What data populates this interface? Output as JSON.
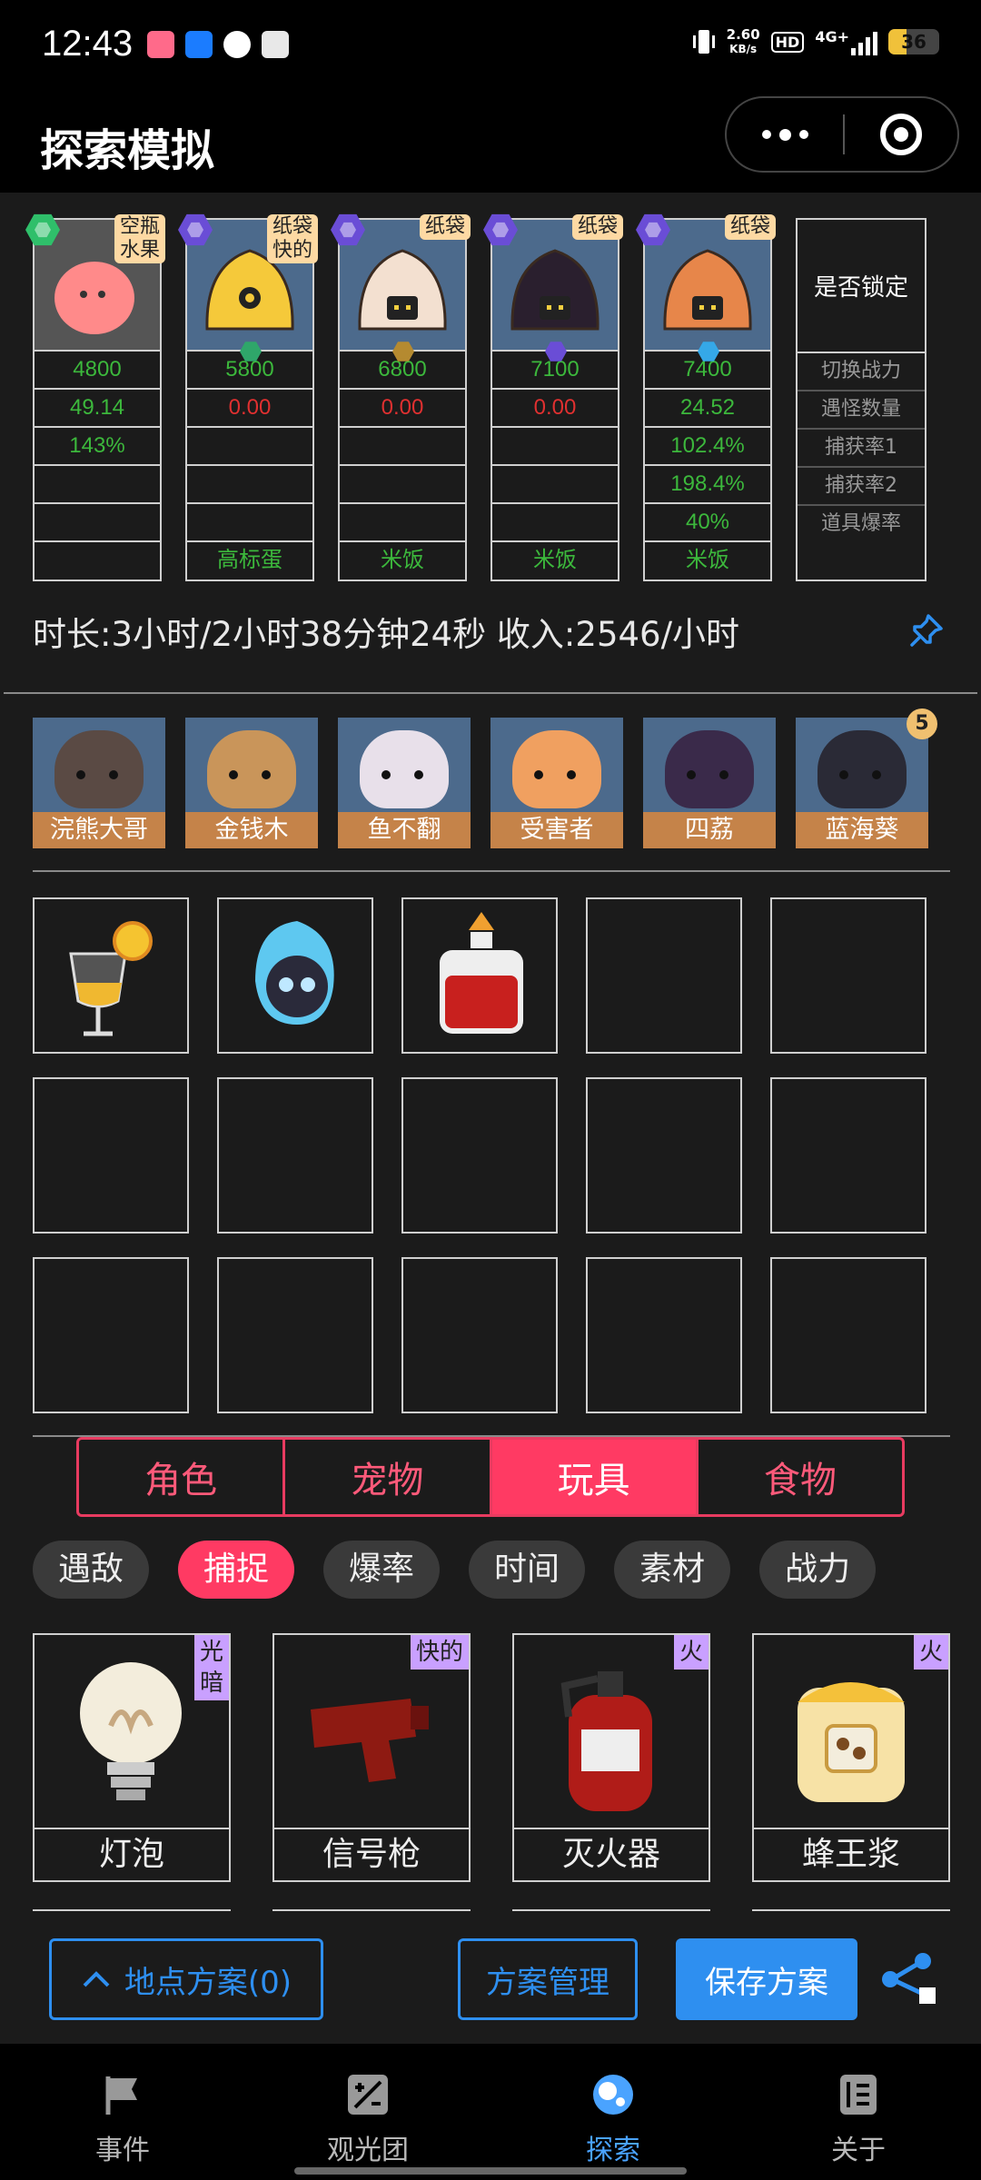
{
  "status": {
    "time": "12:43",
    "speed_top": "2.60",
    "speed_bottom": "KB/s",
    "hd": "HD",
    "network": "4G+",
    "battery": "36",
    "battery_level": 0.36
  },
  "title": "探索模拟",
  "team": [
    {
      "tag": "空瓶\n水果",
      "power": "4800",
      "escape": "49.14",
      "rate1": "143%",
      "rate2": "",
      "drop": "",
      "egg": "",
      "escape_color": "green"
    },
    {
      "tag": "纸袋\n快的",
      "power": "5800",
      "escape": "0.00",
      "rate1": "",
      "rate2": "",
      "drop": "",
      "egg": "高标蛋",
      "escape_color": "red"
    },
    {
      "tag": "纸袋",
      "power": "6800",
      "escape": "0.00",
      "rate1": "",
      "rate2": "",
      "drop": "",
      "egg": "米饭",
      "escape_color": "red"
    },
    {
      "tag": "纸袋",
      "power": "7100",
      "escape": "0.00",
      "rate1": "",
      "rate2": "",
      "drop": "",
      "egg": "米饭",
      "escape_color": "red"
    },
    {
      "tag": "纸袋",
      "power": "7400",
      "escape": "24.52",
      "rate1": "102.4%",
      "rate2": "198.4%",
      "drop": "40%",
      "egg": "米饭",
      "escape_color": "green"
    }
  ],
  "labels": {
    "lock": "是否锁定",
    "power": "切换战力",
    "escape": "遇怪数量",
    "rate1": "捕获率1",
    "rate2": "捕获率2",
    "drop": "道具爆率"
  },
  "summary": "时长:3小时/2小时38分钟24秒 收入:2546/小时",
  "pets": [
    {
      "name": "浣熊大哥"
    },
    {
      "name": "金钱木"
    },
    {
      "name": "鱼不翻"
    },
    {
      "name": "受害者"
    },
    {
      "name": "四荔"
    },
    {
      "name": "蓝海葵",
      "badge": "5"
    }
  ],
  "category_tabs": [
    "角色",
    "宠物",
    "玩具",
    "食物"
  ],
  "active_tab": "玩具",
  "filter_chips": [
    "遇敌",
    "捕捉",
    "爆率",
    "时间",
    "素材",
    "战力"
  ],
  "active_chip": "捕捉",
  "toys": [
    {
      "name": "灯泡",
      "tag": "光\n暗"
    },
    {
      "name": "信号枪",
      "tag": "快的"
    },
    {
      "name": "灭火器",
      "tag": "火"
    },
    {
      "name": "蜂王浆",
      "tag": "火"
    }
  ],
  "actions": {
    "location_plan": "地点方案(0)",
    "plan_manage": "方案管理",
    "save_plan": "保存方案"
  },
  "tabbar": [
    "事件",
    "观光团",
    "探索",
    "关于"
  ],
  "active_tabbar": "探索",
  "colors": {
    "accent_pink": "#ff3a63",
    "accent_blue": "#2e8ff0",
    "green": "#3cb83c",
    "red": "#e03030"
  }
}
